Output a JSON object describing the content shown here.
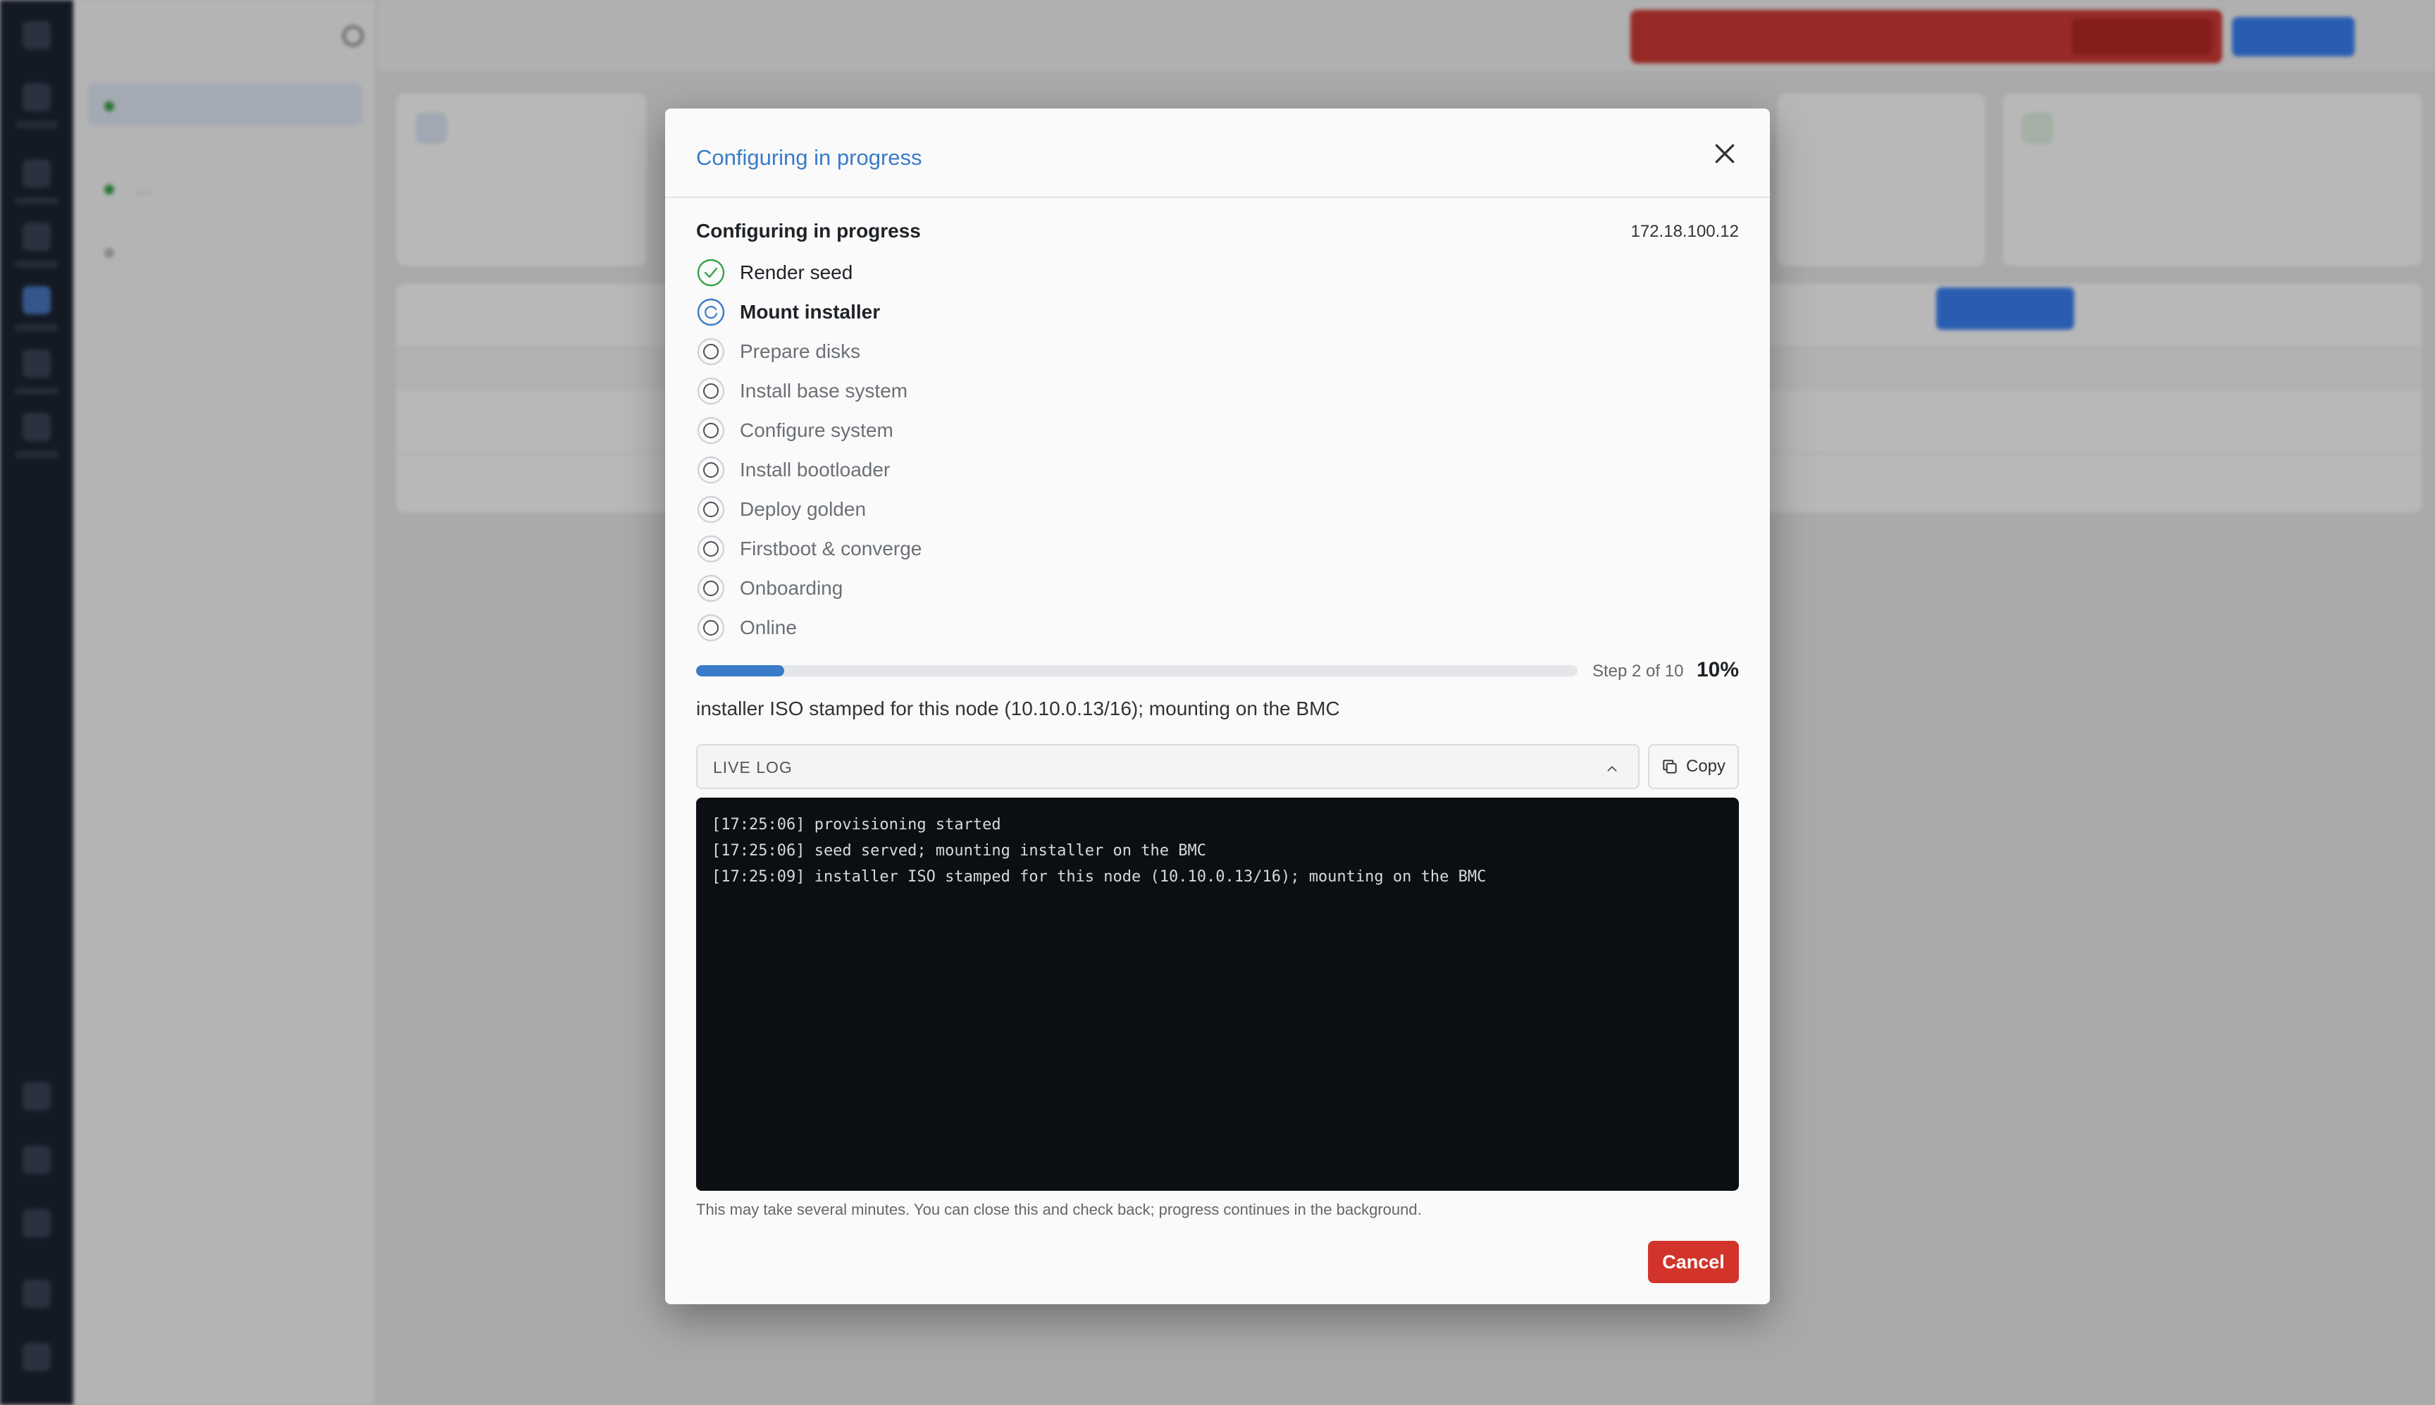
{
  "modal": {
    "title": "Configuring in progress",
    "progress_title": "Configuring in progress",
    "ip": "172.18.100.12",
    "steps": [
      {
        "label": "Render seed",
        "state": "done"
      },
      {
        "label": "Mount installer",
        "state": "active"
      },
      {
        "label": "Prepare disks",
        "state": "pending"
      },
      {
        "label": "Install base system",
        "state": "pending"
      },
      {
        "label": "Configure system",
        "state": "pending"
      },
      {
        "label": "Install bootloader",
        "state": "pending"
      },
      {
        "label": "Deploy golden",
        "state": "pending"
      },
      {
        "label": "Firstboot & converge",
        "state": "pending"
      },
      {
        "label": "Onboarding",
        "state": "pending"
      },
      {
        "label": "Online",
        "state": "pending"
      }
    ],
    "progress_percent": 10,
    "step_count": "Step 2 of 10",
    "percent_label": "10%",
    "status_message": "installer ISO stamped for this node (10.10.0.13/16); mounting on the BMC",
    "log_label": "LIVE LOG",
    "copy_label": "Copy",
    "log_lines": [
      "[17:25:06] provisioning started",
      "[17:25:06] seed served; mounting installer on the BMC",
      "[17:25:09] installer ISO stamped for this node (10.10.0.13/16); mounting on the BMC"
    ],
    "footnote": "This may take several minutes. You can close this and check back; progress continues in the background.",
    "cancel_label": "Cancel"
  },
  "colors": {
    "accent": "#3a7bc8",
    "success": "#37a34a",
    "danger": "#d2332b",
    "terminal_bg": "#0b0e13"
  }
}
